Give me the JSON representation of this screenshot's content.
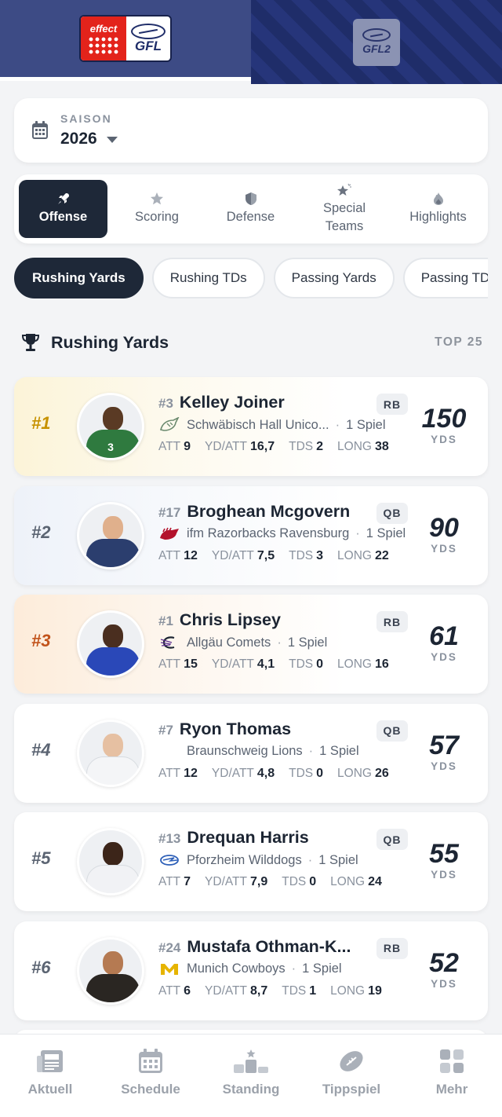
{
  "leagues": [
    {
      "logo_name": "effect GFL",
      "logo_text_brand": "effect",
      "logo_text_league": "GFL",
      "active": true
    },
    {
      "logo_name": "GFL2",
      "logo_text_league": "GFL2",
      "active": false
    }
  ],
  "season": {
    "label": "SAISON",
    "value": "2026"
  },
  "category_tabs": [
    {
      "label": "Offense",
      "icon": "rocket-icon",
      "active": true
    },
    {
      "label": "Scoring",
      "icon": "star-icon",
      "active": false
    },
    {
      "label": "Defense",
      "icon": "shield-icon",
      "active": false
    },
    {
      "label": "Special Teams",
      "icon": "sparkle-star-icon",
      "active": false
    },
    {
      "label": "Highlights",
      "icon": "flame-icon",
      "active": false
    }
  ],
  "stat_pills": [
    {
      "label": "Rushing Yards",
      "active": true
    },
    {
      "label": "Rushing TDs",
      "active": false
    },
    {
      "label": "Passing Yards",
      "active": false
    },
    {
      "label": "Passing TDs",
      "active": false
    }
  ],
  "section": {
    "title": "Rushing Yards",
    "badge": "TOP 25",
    "icon": "trophy-icon"
  },
  "labels": {
    "att": "ATT",
    "ydatt": "YD/ATT",
    "tds": "TDS",
    "long": "LONG",
    "unit": "YDS",
    "separator": "·"
  },
  "players": [
    {
      "rank": "#1",
      "number": "#3",
      "name": "Kelley Joiner",
      "position": "RB",
      "team": "Schwäbisch Hall Unico...",
      "games": "1 Spiel",
      "att": "9",
      "ydatt": "16,7",
      "tds": "2",
      "long": "38",
      "yards": "150"
    },
    {
      "rank": "#2",
      "number": "#17",
      "name": "Broghean Mcgovern",
      "position": "QB",
      "team": "ifm Razorbacks Ravensburg",
      "games": "1 Spiel",
      "att": "12",
      "ydatt": "7,5",
      "tds": "3",
      "long": "22",
      "yards": "90"
    },
    {
      "rank": "#3",
      "number": "#1",
      "name": "Chris Lipsey",
      "position": "RB",
      "team": "Allgäu Comets",
      "games": "1 Spiel",
      "att": "15",
      "ydatt": "4,1",
      "tds": "0",
      "long": "16",
      "yards": "61"
    },
    {
      "rank": "#4",
      "number": "#7",
      "name": "Ryon Thomas",
      "position": "QB",
      "team": "Braunschweig Lions",
      "games": "1 Spiel",
      "att": "12",
      "ydatt": "4,8",
      "tds": "0",
      "long": "26",
      "yards": "57"
    },
    {
      "rank": "#5",
      "number": "#13",
      "name": "Drequan Harris",
      "position": "QB",
      "team": "Pforzheim Wilddogs",
      "games": "1 Spiel",
      "att": "7",
      "ydatt": "7,9",
      "tds": "0",
      "long": "24",
      "yards": "55"
    },
    {
      "rank": "#6",
      "number": "#24",
      "name": "Mustafa Othman-K...",
      "position": "RB",
      "team": "Munich Cowboys",
      "games": "1 Spiel",
      "att": "6",
      "ydatt": "8,7",
      "tds": "1",
      "long": "19",
      "yards": "52"
    }
  ],
  "bottom_nav": [
    {
      "label": "Aktuell",
      "icon": "newspaper-icon"
    },
    {
      "label": "Schedule",
      "icon": "calendar-icon"
    },
    {
      "label": "Standing",
      "icon": "podium-icon"
    },
    {
      "label": "Tippspiel",
      "icon": "football-icon"
    },
    {
      "label": "Mehr",
      "icon": "grid-icon"
    }
  ],
  "colors": {
    "accent": "#1e2838",
    "gold": "#c79200",
    "bronze": "#c2541c",
    "header": "#3d4b85",
    "header_alt": "#1f2d69"
  }
}
